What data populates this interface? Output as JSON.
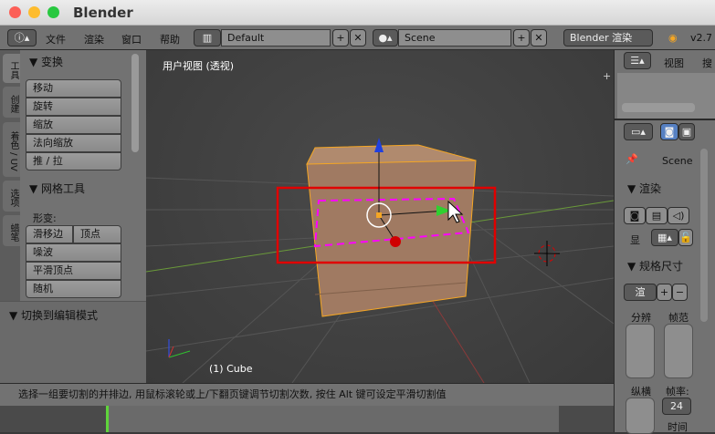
{
  "window": {
    "title": "Blender"
  },
  "menu": {
    "items": [
      "文件",
      "渲染",
      "窗口",
      "帮助"
    ],
    "layout": "Default",
    "scene": "Scene",
    "engine": "Blender 渲染",
    "version": "v2.7"
  },
  "left_tabs": [
    "工具",
    "创建",
    "着色 / UV",
    "选项",
    "蜡笔"
  ],
  "tool_panel": {
    "transform": {
      "title": "▼ 变换",
      "buttons": [
        "移动",
        "旋转",
        "缩放",
        "法向缩放",
        "推 / 拉"
      ]
    },
    "mesh_tools": {
      "title": "▼ 网格工具",
      "deform_label": "形变:",
      "slide_edge": "滑移边",
      "vertex": "顶点",
      "buttons": [
        "噪波",
        "平滑顶点",
        "随机"
      ]
    },
    "toggle_edit": "▼ 切换到编辑模式"
  },
  "viewport": {
    "label": "用户视图 (透视)",
    "object": "(1) Cube"
  },
  "status": {
    "text": "选择一组要切割的并排边, 用鼠标滚轮或上/下翻页键调节切割次数, 按住 Alt 键可设定平滑切割值"
  },
  "outliner": {
    "view": "视图",
    "search": "搜"
  },
  "properties": {
    "scene": "Scene",
    "render_title": "▼ 渲染",
    "display_label": "显",
    "dimensions_title": "▼ 规格尺寸",
    "preset": "渲",
    "resolution": "分辨",
    "frame_range": "帧范",
    "aspect": "纵横",
    "frame_rate_label": "帧率:",
    "frame_rate": "24",
    "time": "时间"
  },
  "colors": {
    "accent": "#f5a623",
    "selection_box": "#e00000",
    "loop_cut": "#ff00ff",
    "frame_marker": "#5fd43b"
  }
}
